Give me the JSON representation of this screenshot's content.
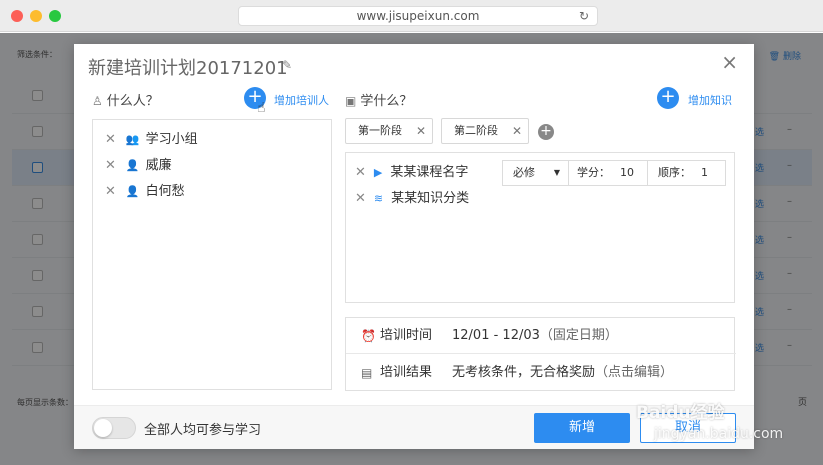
{
  "browser": {
    "url": "www.jisupeixun.com"
  },
  "background": {
    "filter_label": "筛选条件：",
    "delete_label": "删除",
    "row_tail": "选",
    "row_dash": "–",
    "page_size_label": "每页显示条数：",
    "page_suffix": "页"
  },
  "modal": {
    "title": "新建培训计划20171201",
    "who": {
      "heading": "什么人？",
      "add_label": "增加培训人",
      "people": [
        {
          "name": "学习小组"
        },
        {
          "name": "威廉"
        },
        {
          "name": "白何愁"
        }
      ]
    },
    "what": {
      "heading": "学什么？",
      "add_label": "增加知识",
      "tabs": [
        {
          "label": "第一阶段"
        },
        {
          "label": "第二阶段"
        }
      ],
      "items": [
        {
          "name": "某某课程名字"
        },
        {
          "name": "某某知识分类"
        }
      ],
      "requirement": "必修",
      "credit_label": "学分：",
      "credit_value": "10",
      "order_label": "顺序：",
      "order_value": "1"
    },
    "info": {
      "time_label": "培训时间",
      "time_value": "12/01 - 12/03",
      "time_note": "（固定日期）",
      "result_label": "培训结果",
      "result_value": "无考核条件，无合格奖励",
      "result_note": "（点击编辑）"
    },
    "footer": {
      "toggle_label": "全部人均可参与学习",
      "submit_label": "新增",
      "cancel_label": "取消"
    }
  },
  "watermark": {
    "line1": "Baidu经验",
    "line2": "jingyan.baidu.com"
  },
  "colors": {
    "primary": "#2d8cf0"
  }
}
